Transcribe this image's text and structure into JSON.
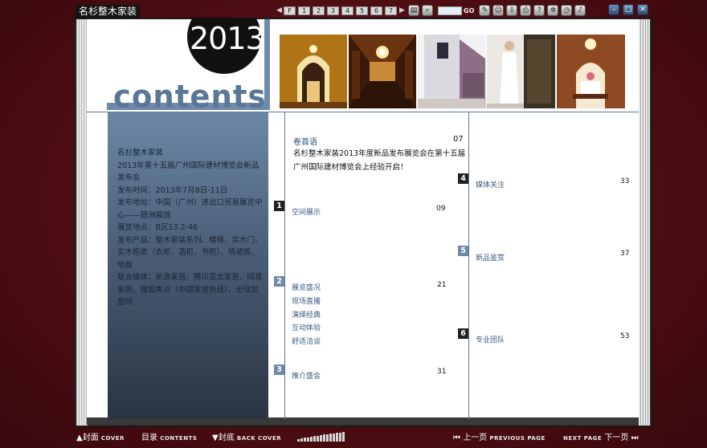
{
  "app": {
    "title": "名杉整木家装"
  },
  "topbar": {
    "pager": {
      "prev_icon": "◀",
      "next_icon": "▶",
      "pages": [
        "F",
        "1",
        "2",
        "3",
        "4",
        "5",
        "6",
        "7"
      ]
    },
    "goto_label": "GO",
    "tools": [
      "save-icon",
      "zoom-icon",
      "comment-icon",
      "user-icon",
      "download-icon",
      "print-icon",
      "help-icon",
      "settings-icon",
      "clock-icon",
      "sound-icon"
    ],
    "window": [
      "minimize-icon",
      "maximize-icon",
      "close-icon"
    ]
  },
  "cover": {
    "year": "2013",
    "heading": "contents",
    "accent_color": "#6f8aa8"
  },
  "info": {
    "lines": [
      "名杉整木家装",
      "2013年第十五届广州国际建材博览会新品发布会",
      "发布时间：2013年7月8日-11日",
      "发布地址：中国（广州）进出口贸易展览中心——琶洲展馆",
      "展览地点：B区13.2-46",
      "发布产品：整木家装系列、楼梯、实木门、实木柜类（衣柜、酒柜、书柜）、墙裙板、地板",
      "联合媒体：新浪家居、腾讯亚太家居、网易家居、搜狐焦点（中国家居热线）、全球加盟网"
    ]
  },
  "toc": {
    "preface": {
      "title": "卷首语",
      "page": "07",
      "text": "名杉整木家装2013年度新品发布展览会在第十五届广州国际建材博览会上经验开启！"
    },
    "sections": [
      {
        "badge": "1",
        "items": [
          "空间展示"
        ],
        "page": "09"
      },
      {
        "badge": "2",
        "items": [
          "展览盛况",
          "现场直播",
          "演绎经典",
          "互动体验",
          "舒适洽谈"
        ],
        "page": "21"
      },
      {
        "badge": "3",
        "items": [
          "推介盛会"
        ],
        "page": "31"
      },
      {
        "badge": "4",
        "items": [
          "媒体关注"
        ],
        "page": "33"
      },
      {
        "badge": "5",
        "items": [
          "新品鉴赏"
        ],
        "page": "37"
      },
      {
        "badge": "6",
        "items": [
          "专业团队"
        ],
        "page": "53"
      }
    ]
  },
  "bottombar": {
    "cover": {
      "zh": "封面",
      "en": "COVER"
    },
    "contents": {
      "zh": "目录",
      "en": "CONTENTS"
    },
    "back_cover": {
      "zh": "封底",
      "en": "BACK COVER"
    },
    "prev": {
      "zh": "上一页",
      "en": "PREVIOUS PAGE"
    },
    "next": {
      "en": "NEXT PAGE",
      "zh": "下一页"
    }
  }
}
